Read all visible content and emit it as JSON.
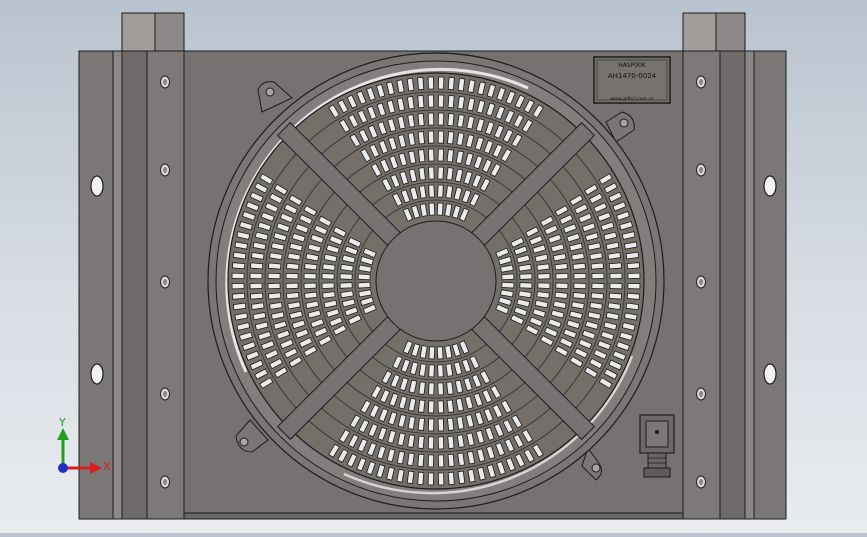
{
  "viewport": {
    "background_top": "#b9c3cf",
    "background_bottom": "#e9ecef",
    "part_fill": "#767271",
    "part_fill_light": "#8a8685",
    "edge_color": "#1c1c1c"
  },
  "nameplate": {
    "line1": "HASP00K",
    "line2": "AH1470-0024",
    "line3": "www.jadhcl.com.cn"
  },
  "triad": {
    "x_label": "X",
    "y_label": "Y",
    "x_color": "#d81e1e",
    "y_color": "#20a020",
    "origin_color": "#2030c0"
  },
  "icons": [
    "coordinate-triad-icon",
    "connector-icon"
  ]
}
